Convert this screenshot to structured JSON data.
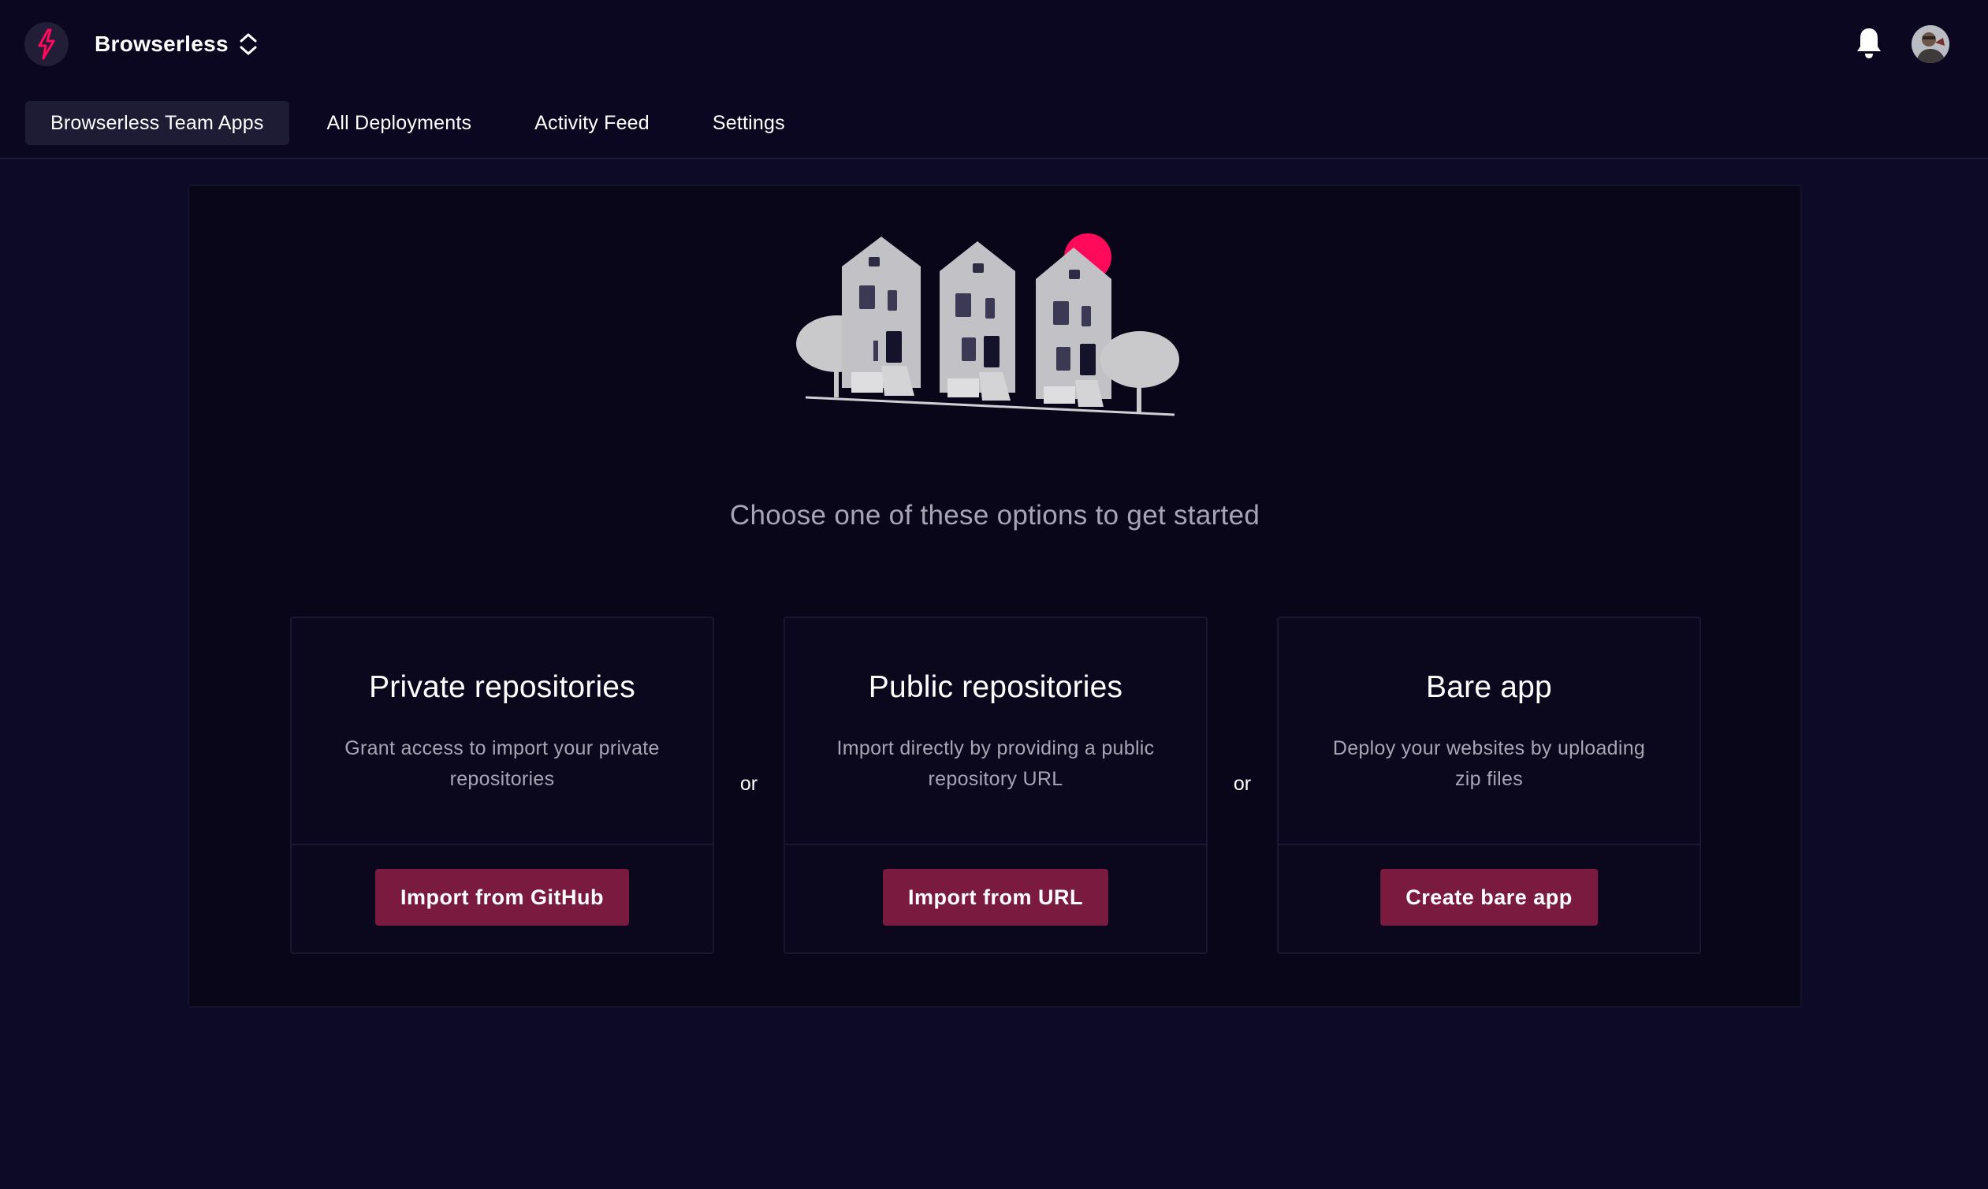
{
  "header": {
    "brand_name": "Browserless",
    "brand_icon": "lightning-bolt-icon",
    "switcher_icon": "chevron-up-down-icon",
    "notifications_icon": "bell-icon",
    "avatar_icon": "user-avatar"
  },
  "nav": {
    "tabs": [
      {
        "label": "Browserless Team Apps",
        "active": true
      },
      {
        "label": "All Deployments",
        "active": false
      },
      {
        "label": "Activity Feed",
        "active": false
      },
      {
        "label": "Settings",
        "active": false
      }
    ]
  },
  "main": {
    "illustration": "houses-illustration",
    "tagline": "Choose one of these options to get started",
    "separator": "or",
    "cards": [
      {
        "title": "Private repositories",
        "description": "Grant access to import your private repositories",
        "button": "Import from GitHub"
      },
      {
        "title": "Public repositories",
        "description": "Import directly by providing a public repository URL",
        "button": "Import from URL"
      },
      {
        "title": "Bare app",
        "description": "Deploy your websites by uploading zip files",
        "button": "Create bare app"
      }
    ]
  },
  "colors": {
    "background": "#0c0a26",
    "header": "#0b0720",
    "panel": "#090619",
    "accent_button": "#7b1a3f",
    "brand_red": "#ff0a5a"
  }
}
